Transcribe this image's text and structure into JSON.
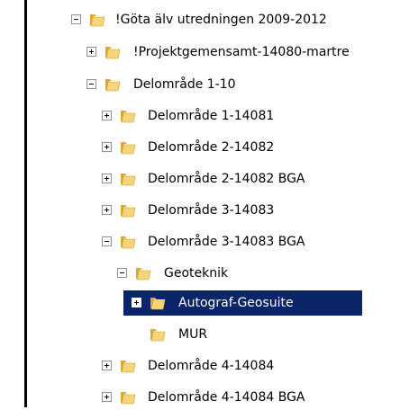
{
  "tree": {
    "nodes": [
      {
        "label": "!Göta älv utredningen 2009-2012",
        "expander": "minus",
        "selected": false
      },
      {
        "label": "!Projektgemensamt-14080-martre",
        "expander": "plus",
        "selected": false
      },
      {
        "label": "Delområde 1-10",
        "expander": "minus",
        "selected": false
      },
      {
        "label": "Delområde 1-14081",
        "expander": "plus",
        "selected": false
      },
      {
        "label": "Delområde 2-14082",
        "expander": "plus",
        "selected": false
      },
      {
        "label": "Delområde 2-14082 BGA",
        "expander": "plus",
        "selected": false
      },
      {
        "label": "Delområde 3-14083",
        "expander": "plus",
        "selected": false
      },
      {
        "label": "Delområde 3-14083 BGA",
        "expander": "minus",
        "selected": false
      },
      {
        "label": "Geoteknik",
        "expander": "minus",
        "selected": false
      },
      {
        "label": "Autograf-Geosuite",
        "expander": "plus",
        "selected": true
      },
      {
        "label": "MUR",
        "expander": "none",
        "selected": false
      },
      {
        "label": "Delområde 4-14084",
        "expander": "plus",
        "selected": false
      },
      {
        "label": "Delområde 4-14084 BGA",
        "expander": "plus",
        "selected": false
      }
    ]
  },
  "colors": {
    "selection": "#0a246a",
    "folder_front": "#f6d57a",
    "folder_back": "#d9a93a"
  },
  "icons": {
    "folder": "folder-icon",
    "expand": "expand-plus-icon",
    "collapse": "collapse-minus-icon"
  }
}
